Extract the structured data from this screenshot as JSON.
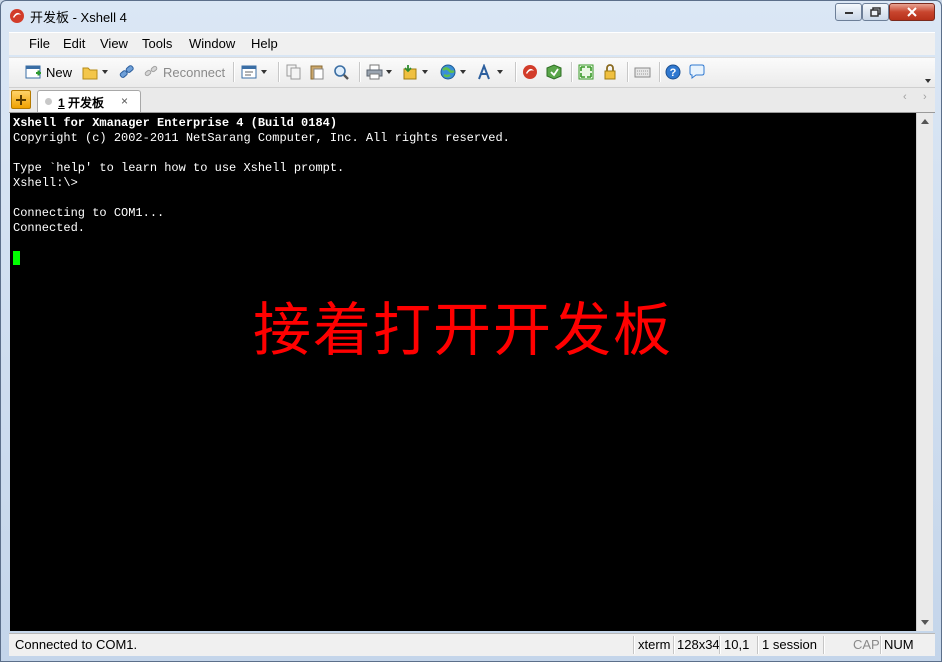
{
  "window": {
    "title": "开发板 - Xshell 4"
  },
  "menu": [
    "File",
    "Edit",
    "View",
    "Tools",
    "Window",
    "Help"
  ],
  "toolbar": {
    "new_label": "New",
    "reconnect_label": "Reconnect"
  },
  "tab": {
    "number": "1",
    "name": "开发板",
    "close": "×"
  },
  "terminal": {
    "lines": [
      "Xshell for Xmanager Enterprise 4 (Build 0184)",
      "Copyright (c) 2002-2011 NetSarang Computer, Inc. All rights reserved.",
      "",
      "Type `help' to learn how to use Xshell prompt.",
      "Xshell:\\>",
      "",
      "Connecting to COM1...",
      "Connected."
    ],
    "overlay_text": "接着打开开发板",
    "colors": {
      "background": "#000000",
      "text": "#ffffff",
      "cursor": "#00ff00",
      "overlay": "#ff0000"
    }
  },
  "status": {
    "connection": "Connected to COM1.",
    "terminal_type": "xterm",
    "size": "128x34",
    "cursor_pos": "10,1",
    "sessions": "1 session",
    "cap": "CAP",
    "num": "NUM"
  }
}
